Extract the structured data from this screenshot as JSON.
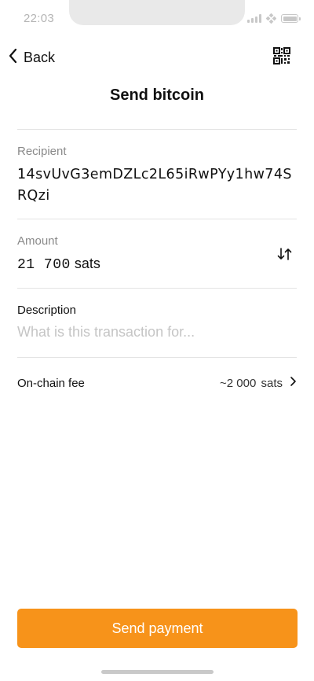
{
  "status_bar": {
    "time": "22:03"
  },
  "header": {
    "back_label": "Back",
    "title": "Send bitcoin"
  },
  "recipient": {
    "label": "Recipient",
    "address": "14svUvG3emDZLc2L65iRwPYy1hw74SRQzi"
  },
  "amount": {
    "label": "Amount",
    "value": "21 700",
    "unit": "sats"
  },
  "description": {
    "label": "Description",
    "placeholder": "What is this transaction for...",
    "value": ""
  },
  "fee": {
    "label": "On-chain fee",
    "value": "~2 000",
    "unit": "sats"
  },
  "send_button": {
    "label": "Send payment"
  },
  "colors": {
    "accent": "#f7931a",
    "muted": "#8a8a8a",
    "divider": "#e3e3e3"
  }
}
